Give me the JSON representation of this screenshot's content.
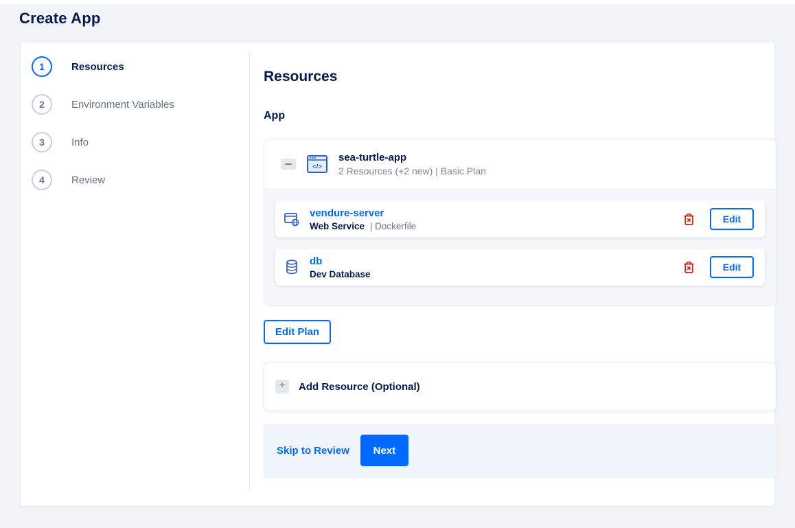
{
  "page": {
    "title": "Create App"
  },
  "colors": {
    "accent_blue": "#0069ff",
    "navy": "#031b4e",
    "danger_red": "#cf2318",
    "page_background": "#f1f3f6",
    "footer_background": "#f0f5fb"
  },
  "sidebar": {
    "steps": [
      {
        "number": "1",
        "label": "Resources",
        "active": true
      },
      {
        "number": "2",
        "label": "Environment Variables",
        "active": false
      },
      {
        "number": "3",
        "label": "Info",
        "active": false
      },
      {
        "number": "4",
        "label": "Review",
        "active": false
      }
    ]
  },
  "content": {
    "heading": "Resources",
    "section_label": "App",
    "app": {
      "name": "sea-turtle-app",
      "summary": "2 Resources (+2 new) | Basic Plan",
      "resources": [
        {
          "name": "vendure-server",
          "type": "Web Service",
          "detail": "| Dockerfile",
          "icon": "web-service-icon",
          "edit_label": "Edit"
        },
        {
          "name": "db",
          "type": "Dev Database",
          "detail": "",
          "icon": "database-icon",
          "edit_label": "Edit"
        }
      ]
    },
    "edit_plan_label": "Edit Plan",
    "add_resource": {
      "label": "Add Resource (Optional)"
    },
    "footer": {
      "skip_label": "Skip to Review",
      "next_label": "Next"
    }
  }
}
